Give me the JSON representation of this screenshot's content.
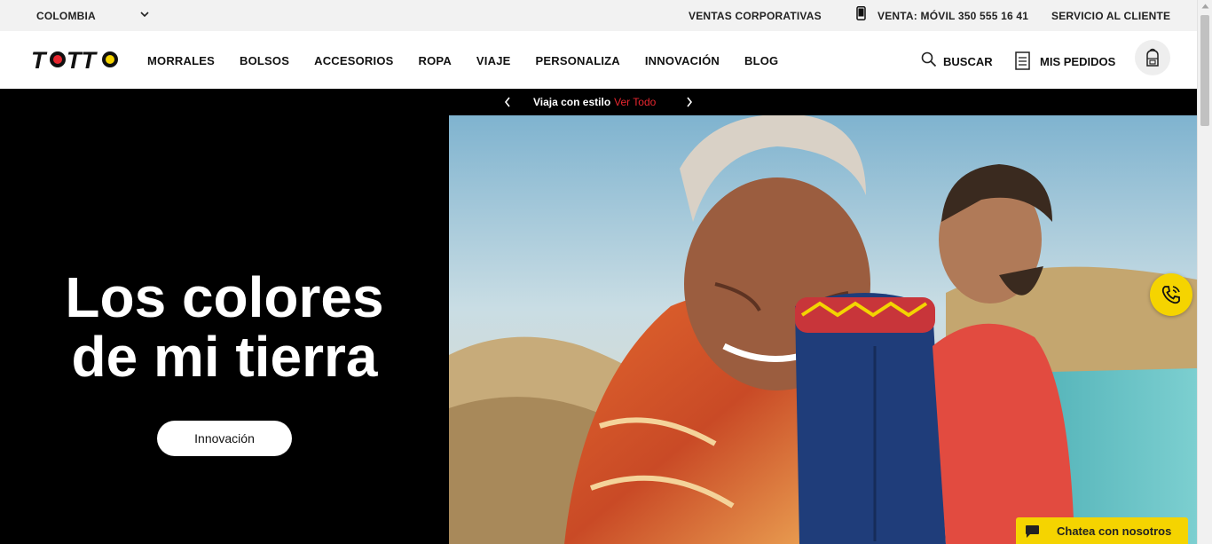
{
  "topbar": {
    "country": "COLOMBIA",
    "corporate_sales": "VENTAS CORPORATIVAS",
    "phone_sales": "VENTA: MÓVIL 350 555 16 41",
    "customer_service": "SERVICIO AL CLIENTE"
  },
  "nav": {
    "logo": "TOTTO",
    "menu": [
      "MORRALES",
      "BOLSOS",
      "ACCESORIOS",
      "ROPA",
      "VIAJE",
      "PERSONALIZA",
      "INNOVACIÓN",
      "BLOG"
    ],
    "search_label": "BUSCAR",
    "orders_label": "MIS PEDIDOS"
  },
  "promo": {
    "text": "Viaja con estilo",
    "link": "Ver Todo"
  },
  "hero": {
    "title_line1": "Los colores",
    "title_line2": "de mi tierra",
    "button_label": "Innovación"
  },
  "chat": {
    "label": "Chatea con nosotros"
  },
  "colors": {
    "brand_yellow": "#f5d400",
    "accent_red": "#e8262f",
    "hero_bg": "#000000"
  },
  "icons": [
    "chevron-down-icon",
    "mobile-phone-icon",
    "search-icon",
    "orders-list-icon",
    "backpack-icon",
    "chevron-left-icon",
    "chevron-right-icon",
    "phone-call-icon",
    "chat-bubble-icon"
  ]
}
